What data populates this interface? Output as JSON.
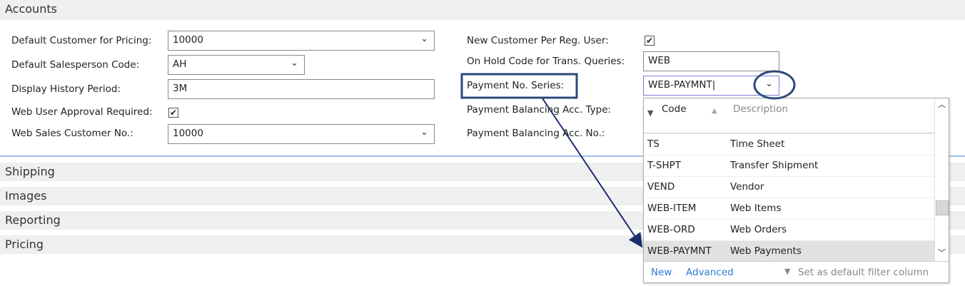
{
  "sections": {
    "accounts": "Accounts",
    "shipping": "Shipping",
    "images": "Images",
    "reporting": "Reporting",
    "pricing": "Pricing"
  },
  "left_fields": [
    {
      "label": "Default Customer for Pricing:",
      "value": "10000"
    },
    {
      "label": "Default Salesperson Code:",
      "value": "AH"
    },
    {
      "label": "Display History Period:",
      "value": "3M"
    },
    {
      "label": "Web User Approval Required:",
      "checked": true
    },
    {
      "label": "Web Sales Customer No.:",
      "value": "10000"
    }
  ],
  "right_fields": [
    {
      "label": "New Customer Per Reg. User:",
      "checked": true
    },
    {
      "label": "On Hold Code for Trans. Queries:",
      "value": "WEB"
    },
    {
      "label": "Payment No. Series:",
      "value": "WEB-PAYMNT"
    },
    {
      "label": "Payment Balancing Acc. Type:"
    },
    {
      "label": "Payment Balancing Acc. No.:"
    }
  ],
  "lookup": {
    "col_code": "Code",
    "col_desc": "Description",
    "rows": [
      {
        "code": "TS",
        "desc": "Time Sheet"
      },
      {
        "code": "T-SHPT",
        "desc": "Transfer Shipment"
      },
      {
        "code": "VEND",
        "desc": "Vendor"
      },
      {
        "code": "WEB-ITEM",
        "desc": "Web Items"
      },
      {
        "code": "WEB-ORD",
        "desc": "Web Orders"
      },
      {
        "code": "WEB-PAYMNT",
        "desc": "Web Payments"
      }
    ],
    "new": "New",
    "advanced": "Advanced",
    "default_filter": "Set as default filter column"
  },
  "annotation_color": "#2e4a7a"
}
